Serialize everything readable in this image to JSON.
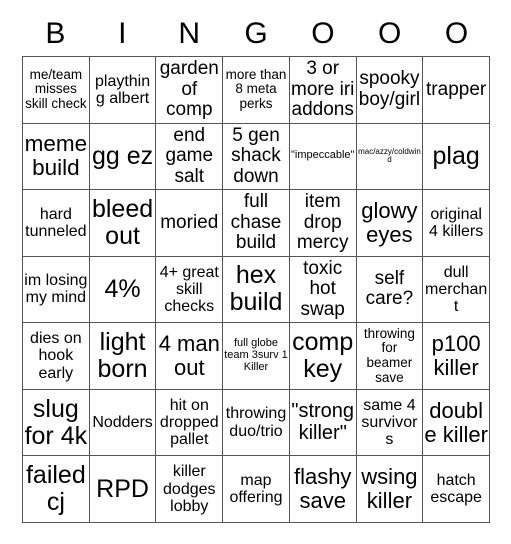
{
  "card": {
    "title": "BINGOOO",
    "columns": 7,
    "rows": 7,
    "grid_line_color": "#555555",
    "background_color": "#ffffff",
    "text_color": "#000000"
  },
  "header": {
    "letters": [
      "B",
      "I",
      "N",
      "G",
      "O",
      "O",
      "O"
    ]
  },
  "cells": [
    [
      {
        "text": "me/team misses skill check",
        "size": "sm"
      },
      {
        "text": "plaything albert",
        "size": "md"
      },
      {
        "text": "garden of comp",
        "size": "lg"
      },
      {
        "text": "more than 8 meta perks",
        "size": "sm"
      },
      {
        "text": "3 or more iri addons",
        "size": "lg"
      },
      {
        "text": "spooky boy/girl",
        "size": "lg"
      },
      {
        "text": "trapper",
        "size": "lg"
      }
    ],
    [
      {
        "text": "meme build",
        "size": "xxl"
      },
      {
        "text": "gg ez",
        "size": "xxl"
      },
      {
        "text": "end game salt",
        "size": "lg"
      },
      {
        "text": "5 gen shack down",
        "size": "lg"
      },
      {
        "text": "\"impeccable\"",
        "size": "xs"
      },
      {
        "text": "mac/azzy/coldwind",
        "size": "xxs"
      },
      {
        "text": "plag",
        "size": "xxl"
      }
    ],
    [
      {
        "text": "hard tunneled",
        "size": "md"
      },
      {
        "text": "bleed out",
        "size": "xxl"
      },
      {
        "text": "moried",
        "size": "lg"
      },
      {
        "text": "full chase build",
        "size": "lg"
      },
      {
        "text": "item drop mercy",
        "size": "lg"
      },
      {
        "text": "glowy eyes",
        "size": "xl"
      },
      {
        "text": "original 4 killers",
        "size": "md"
      }
    ],
    [
      {
        "text": "im losing my mind",
        "size": "md"
      },
      {
        "text": "4%",
        "size": "xxl"
      },
      {
        "text": "4+ great skill checks",
        "size": "md"
      },
      {
        "text": "hex build",
        "size": "xxl"
      },
      {
        "text": "toxic hot swap",
        "size": "lg"
      },
      {
        "text": "self care?",
        "size": "lg"
      },
      {
        "text": "dull merchant",
        "size": "md"
      }
    ],
    [
      {
        "text": "dies on hook early",
        "size": "md"
      },
      {
        "text": "light born",
        "size": "xxl"
      },
      {
        "text": "4 man out",
        "size": "xl"
      },
      {
        "text": "full globe team 3surv 1 Killer",
        "size": "xs"
      },
      {
        "text": "comp key",
        "size": "xxl"
      },
      {
        "text": "throwing for beamer save",
        "size": "sm"
      },
      {
        "text": "p100 killer",
        "size": "xl"
      }
    ],
    [
      {
        "text": "slug for 4k",
        "size": "xxl"
      },
      {
        "text": "Nodders",
        "size": "md"
      },
      {
        "text": "hit on dropped pallet",
        "size": "md"
      },
      {
        "text": "throwing duo/trio",
        "size": "md"
      },
      {
        "text": "\"strong killer\"",
        "size": "xl"
      },
      {
        "text": "same 4 survivors",
        "size": "md"
      },
      {
        "text": "double killer",
        "size": "xl"
      }
    ],
    [
      {
        "text": "failed cj",
        "size": "xxl"
      },
      {
        "text": "RPD",
        "size": "xxl"
      },
      {
        "text": "killer dodges lobby",
        "size": "md"
      },
      {
        "text": "map offering",
        "size": "md"
      },
      {
        "text": "flashy save",
        "size": "xl"
      },
      {
        "text": "wsing killer",
        "size": "xl"
      },
      {
        "text": "hatch escape",
        "size": "md"
      }
    ]
  ]
}
